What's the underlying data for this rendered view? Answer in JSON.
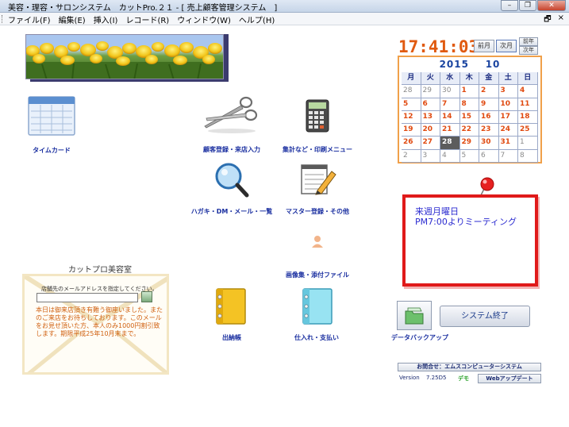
{
  "window": {
    "title": "美容・理容・サロンシステム　カットPro.２１ - [ 売上顧客管理システム　]",
    "minimize_icon": "minimize-icon",
    "restore_icon": "restore-icon",
    "close_icon": "close-icon"
  },
  "menu": {
    "items": [
      "ファイル(F)",
      "編集(E)",
      "挿入(I)",
      "レコード(R)",
      "ウィンドウ(W)",
      "ヘルプ(H)"
    ],
    "mdi_restore": "🗗",
    "mdi_close": "×"
  },
  "launchers": {
    "timecard": "タイムカード",
    "customer": "顧客登録・来店入力",
    "aggregate": "集計など・印刷メニュー",
    "postcard": "ハガキ・DM・メール・一覧",
    "master": "マスター登録・その他",
    "images": "画像集・添付ファイル",
    "ledger": "出納帳",
    "purchase": "仕入れ・支払い"
  },
  "clock": {
    "time": "17:41:03",
    "prev_month": "前月",
    "this_month": "次月",
    "prev_year": "前年",
    "next_year": "次年"
  },
  "calendar": {
    "year": "2015",
    "month": "10",
    "weekdays": [
      "月",
      "火",
      "水",
      "木",
      "金",
      "土",
      "日"
    ],
    "weeks": [
      [
        {
          "d": "28",
          "dim": true
        },
        {
          "d": "29",
          "dim": true
        },
        {
          "d": "30",
          "dim": true
        },
        {
          "d": "1"
        },
        {
          "d": "2"
        },
        {
          "d": "3"
        },
        {
          "d": "4"
        }
      ],
      [
        {
          "d": "5"
        },
        {
          "d": "6"
        },
        {
          "d": "7"
        },
        {
          "d": "8"
        },
        {
          "d": "9"
        },
        {
          "d": "10"
        },
        {
          "d": "11"
        }
      ],
      [
        {
          "d": "12"
        },
        {
          "d": "13"
        },
        {
          "d": "14"
        },
        {
          "d": "15"
        },
        {
          "d": "16"
        },
        {
          "d": "17"
        },
        {
          "d": "18"
        }
      ],
      [
        {
          "d": "19"
        },
        {
          "d": "20"
        },
        {
          "d": "21"
        },
        {
          "d": "22"
        },
        {
          "d": "23"
        },
        {
          "d": "24"
        },
        {
          "d": "25"
        }
      ],
      [
        {
          "d": "26"
        },
        {
          "d": "27"
        },
        {
          "d": "28",
          "today": true
        },
        {
          "d": "29"
        },
        {
          "d": "30"
        },
        {
          "d": "31"
        },
        {
          "d": "1",
          "dim": true
        }
      ],
      [
        {
          "d": "2",
          "dim": true
        },
        {
          "d": "3",
          "dim": true
        },
        {
          "d": "4",
          "dim": true
        },
        {
          "d": "5",
          "dim": true
        },
        {
          "d": "6",
          "dim": true
        },
        {
          "d": "7",
          "dim": true
        },
        {
          "d": "8",
          "dim": true
        }
      ]
    ]
  },
  "memo": {
    "line1": "来週月曜日",
    "line2": "PM7:00よりミーティング"
  },
  "salon": {
    "title": "カットプロ美容室",
    "email_label": "店舗先のメールアドレスを指定してください。",
    "email_value": "",
    "message": "本日は御来店頂き有難う御座いました。またのご来店をお待ちしております。このメールをお見せ頂いた方、本人のみ1000円割引致します。期限平成25年10月末まで。"
  },
  "footer": {
    "backup_label": "データバックアップ",
    "exit_label": "システム終了",
    "contact": "お問合せ：エムスコンピューターシステム",
    "version_label": "Version",
    "version_value": "7.25D5",
    "demo": "デモ",
    "update": "Webアップデート"
  },
  "colors": {
    "clock": "#e05a10",
    "calendar_border": "#f0a04a",
    "memo_border": "#e01a1a",
    "label_blue": "#1a2fa0"
  }
}
